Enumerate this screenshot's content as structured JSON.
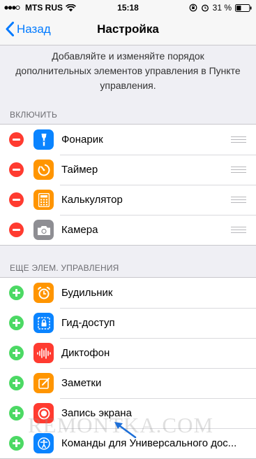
{
  "status_bar": {
    "carrier": "MTS RUS",
    "time": "15:18",
    "battery": "31 %"
  },
  "nav": {
    "back_label": "Назад",
    "title": "Настройка"
  },
  "description": "Добавляйте и изменяйте порядок дополнительных элементов управления в Пункте управления.",
  "include_section": {
    "header": "ВКЛЮЧИТЬ",
    "items": [
      {
        "label": "Фонарик",
        "icon": "flashlight-icon",
        "color": "#0a84ff"
      },
      {
        "label": "Таймер",
        "icon": "timer-icon",
        "color": "#ff9500"
      },
      {
        "label": "Калькулятор",
        "icon": "calculator-icon",
        "color": "#ff9500"
      },
      {
        "label": "Камера",
        "icon": "camera-icon",
        "color": "#8e8e93"
      }
    ]
  },
  "more_section": {
    "header": "ЕЩЕ ЭЛЕМ. УПРАВЛЕНИЯ",
    "items": [
      {
        "label": "Будильник",
        "icon": "alarm-icon",
        "color": "#ff9500"
      },
      {
        "label": "Гид-доступ",
        "icon": "guided-access-icon",
        "color": "#0a84ff"
      },
      {
        "label": "Диктофон",
        "icon": "voice-memos-icon",
        "color": "#ff3b30"
      },
      {
        "label": "Заметки",
        "icon": "notes-icon",
        "color": "#ff9500"
      },
      {
        "label": "Запись экрана",
        "icon": "screen-recording-icon",
        "color": "#ff3b30"
      },
      {
        "label": "Команды для Универсального дос...",
        "icon": "accessibility-icon",
        "color": "#0a84ff"
      }
    ]
  },
  "watermark": "REMONTKA.COM"
}
